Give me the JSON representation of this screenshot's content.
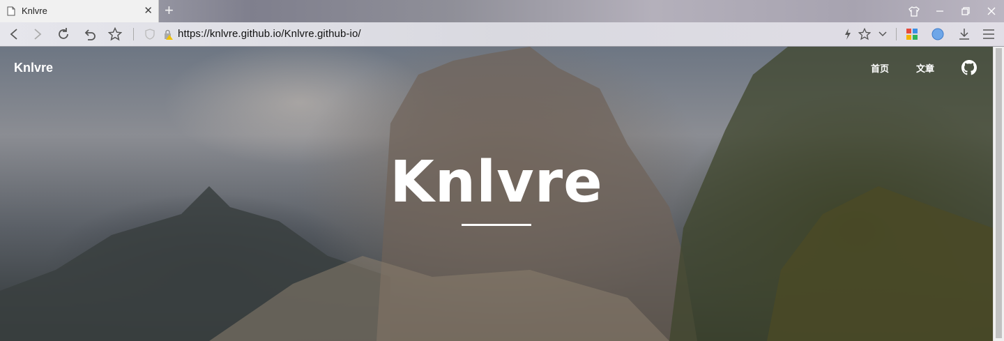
{
  "browser": {
    "tab_title": "Knlvre",
    "new_tab_symbol": "+",
    "close_symbol": "✕",
    "url": "https://knlvre.github.io/Knlvre.github-io/",
    "icons": {
      "page": "page-icon",
      "back": "back-arrow-icon",
      "forward": "forward-arrow-icon",
      "reload": "reload-icon",
      "undo": "undo-icon",
      "bookmark": "star-icon",
      "shield": "shield-icon",
      "lock": "lock-warning-icon",
      "lightning": "lightning-icon",
      "favorite": "star-outline-icon",
      "dropdown": "chevron-down-icon",
      "apps": "apps-grid-icon",
      "globe": "globe-icon",
      "download": "download-icon",
      "menu": "hamburger-icon",
      "skin": "shirt-icon",
      "minimize": "minimize-icon",
      "restore": "restore-icon",
      "close": "close-icon"
    }
  },
  "site": {
    "logo": "Knlvre",
    "nav": [
      {
        "label": "首页"
      },
      {
        "label": "文章"
      }
    ],
    "github_icon": "github-icon",
    "hero_title": "Knlvre"
  }
}
